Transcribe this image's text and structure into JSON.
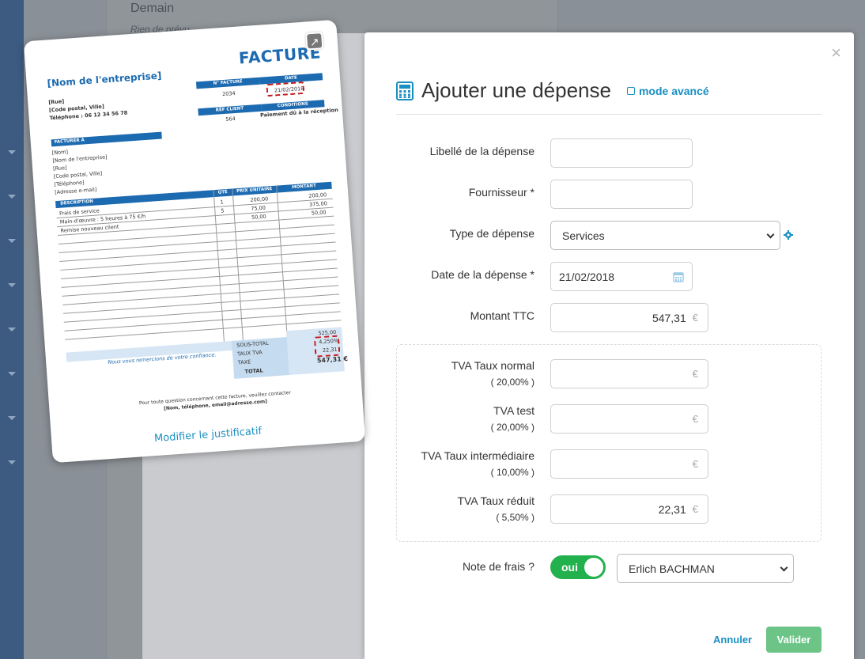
{
  "background": {
    "title": "Demain",
    "subtitle": "Rien de prévu"
  },
  "modal": {
    "title": "Ajouter une dépense",
    "advanced_mode": "mode avancé",
    "close": "×",
    "fields": {
      "libelle": {
        "label": "Libellé de la dépense",
        "value": ""
      },
      "fournisseur": {
        "label": "Fournisseur *",
        "value": ""
      },
      "type": {
        "label": "Type de dépense",
        "value": "Services"
      },
      "date": {
        "label": "Date de la dépense *",
        "value": "21/02/2018"
      },
      "montant": {
        "label": "Montant TTC",
        "value": "547,31",
        "currency": "€"
      }
    },
    "tva": [
      {
        "label": "TVA Taux normal",
        "rate": "( 20,00% )",
        "value": "",
        "currency": "€"
      },
      {
        "label": "TVA test",
        "rate": "( 20,00% )",
        "value": "",
        "currency": "€"
      },
      {
        "label": "TVA Taux intermédiaire",
        "rate": "( 10,00% )",
        "value": "",
        "currency": "€"
      },
      {
        "label": "TVA Taux réduit",
        "rate": "( 5,50% )",
        "value": "22,31",
        "currency": "€"
      }
    ],
    "note_frais": {
      "label": "Note de frais ?",
      "toggle": "oui",
      "person": "Erlich BACHMAN"
    },
    "buttons": {
      "cancel": "Annuler",
      "validate": "Valider"
    },
    "colors": {
      "accent": "#1a8fc2",
      "toggle_on": "#22b14c",
      "validate": "#6cc487"
    }
  },
  "invoice": {
    "title": "FACTURE",
    "company": "[Nom de l'entreprise]",
    "address": [
      "[Rue]",
      "[Code postal, Ville]",
      "Téléphone : 06 12 34 56 78"
    ],
    "no_facture_label": "N° FACTURE",
    "date_label": "DATE",
    "no_facture": "2034",
    "date": "21/02/2018",
    "ref_label": "RÉF CLIENT",
    "conditions_label": "CONDITIONS",
    "ref": "564",
    "conditions": "Paiement dû à la réception",
    "bill_to_label": "FACTURER À",
    "bill_to": [
      "[Nom]",
      "[Nom de l'entreprise]",
      "[Rue]",
      "[Code postal, Ville]",
      "[Téléphone]",
      "[Adresse e-mail]"
    ],
    "cols": [
      "DESCRIPTION",
      "QTÉ",
      "PRIX UNITAIRE",
      "MONTANT"
    ],
    "rows": [
      {
        "desc": "Frais de service",
        "qty": "1",
        "unit": "200,00",
        "amount": "200,00"
      },
      {
        "desc": "Main-d'œuvre : 5 heures à 75 €/h",
        "qty": "5",
        "unit": "75,00",
        "amount": "375,00"
      },
      {
        "desc": "Remise nouveau client",
        "qty": "",
        "unit": "50,00",
        "amount": "50,00"
      }
    ],
    "thanks": "Nous vous remercions de votre confiance.",
    "totals": [
      {
        "label": "SOUS-TOTAL",
        "value": "525,00"
      },
      {
        "label": "TAUX TVA",
        "value": "4,250%"
      },
      {
        "label": "TAXE",
        "value": "22,31"
      },
      {
        "label": "TOTAL",
        "value": "547,31 €"
      }
    ],
    "footer_1": "Pour toute question concernant cette facture, veuillez contacter",
    "footer_2": "[Nom, téléphone, email@adresse.com]",
    "modify_link": "Modifier le justificatif"
  }
}
